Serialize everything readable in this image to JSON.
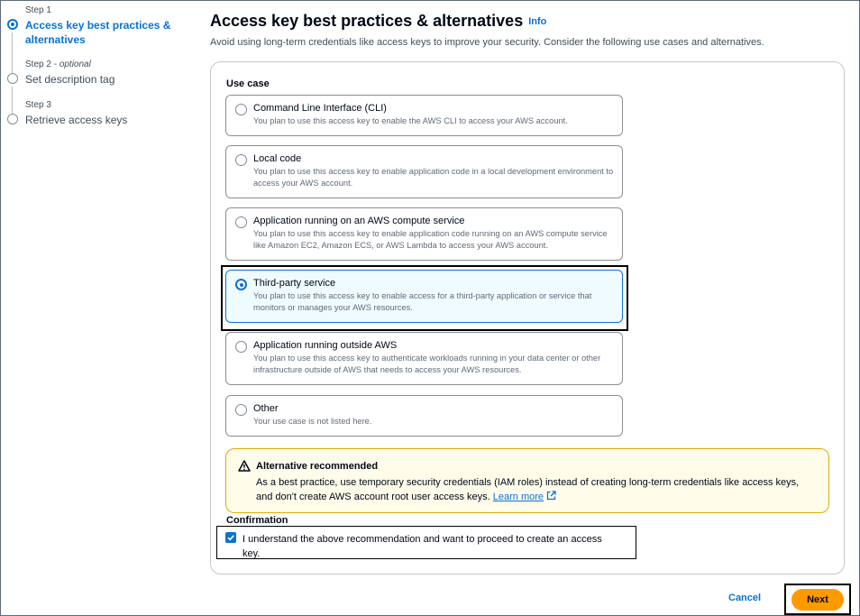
{
  "steps": [
    {
      "num": "Step 1",
      "optional": "",
      "title": "Access key best practices & alternatives",
      "active": true
    },
    {
      "num": "Step 2 - ",
      "optional": "optional",
      "title": "Set description tag",
      "active": false
    },
    {
      "num": "Step 3",
      "optional": "",
      "title": "Retrieve access keys",
      "active": false
    }
  ],
  "header": {
    "title": "Access key best practices & alternatives",
    "info": "Info",
    "description": "Avoid using long-term credentials like access keys to improve your security. Consider the following use cases and alternatives."
  },
  "use_case": {
    "label": "Use case",
    "options": [
      {
        "title": "Command Line Interface (CLI)",
        "desc": "You plan to use this access key to enable the AWS CLI to access your AWS account.",
        "selected": false
      },
      {
        "title": "Local code",
        "desc": "You plan to use this access key to enable application code in a local development environment to access your AWS account.",
        "selected": false
      },
      {
        "title": "Application running on an AWS compute service",
        "desc": "You plan to use this access key to enable application code running on an AWS compute service like Amazon EC2, Amazon ECS, or AWS Lambda to access your AWS account.",
        "selected": false
      },
      {
        "title": "Third-party service",
        "desc": "You plan to use this access key to enable access for a third-party application or service that monitors or manages your AWS resources.",
        "selected": true
      },
      {
        "title": "Application running outside AWS",
        "desc": "You plan to use this access key to authenticate workloads running in your data center or other infrastructure outside of AWS that needs to access your AWS resources.",
        "selected": false
      },
      {
        "title": "Other",
        "desc": "Your use case is not listed here.",
        "selected": false
      }
    ]
  },
  "alert": {
    "title": "Alternative recommended",
    "text": "As a best practice, use temporary security credentials (IAM roles) instead of creating long-term credentials like access keys, and don't create AWS account root user access keys. ",
    "link": "Learn more"
  },
  "confirmation": {
    "label": "Confirmation",
    "text": "I understand the above recommendation and want to proceed to create an access key.",
    "checked": true
  },
  "footer": {
    "cancel": "Cancel",
    "next": "Next"
  },
  "colors": {
    "accent": "#0972d3",
    "primary_button": "#ff9900",
    "warning_border": "#dfa90f",
    "warning_bg": "#fffce9"
  }
}
